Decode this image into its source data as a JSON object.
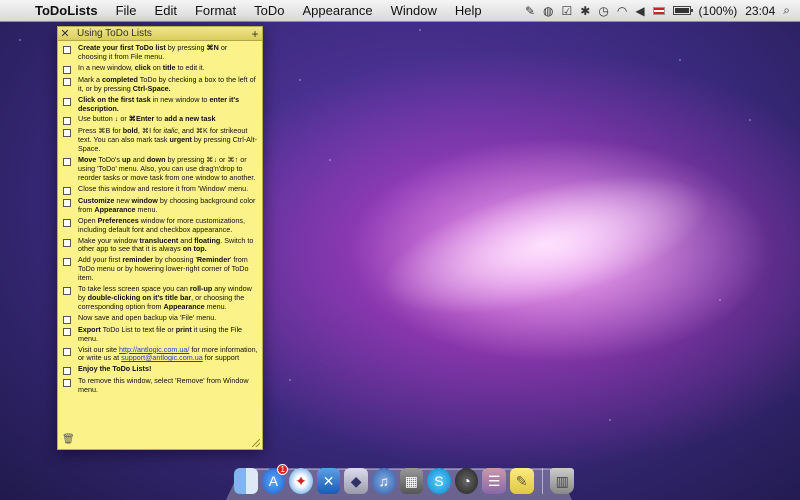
{
  "menubar": {
    "app_name": "ToDoLists",
    "menus": [
      "File",
      "Edit",
      "Format",
      "ToDo",
      "Appearance",
      "Window",
      "Help"
    ],
    "battery_text": "(100%)",
    "clock": "23:04"
  },
  "window": {
    "title": "Using ToDo Lists",
    "tasks": [
      {
        "html": "<b>Create your first ToDo list</b> by pressing <b>⌘N</b> or choosing it from File menu."
      },
      {
        "html": "In a new window, <b>click</b> on <b>title</b> to edit it."
      },
      {
        "html": "Mark a <b>completed</b> ToDo by checking a box to the left of it, or by pressing <b>Ctrl-Space.</b>"
      },
      {
        "html": "<b>Click on the first task</b> in new window to <b>enter it's description.</b>"
      },
      {
        "html": "Use button <b>↓</b> or <b>⌘Enter</b> to <b>add a new task</b>"
      },
      {
        "html": "Press ⌘B for <b>bold</b>, ⌘I for <i>italic</i>, and ⌘K for strikeout text. You can also mark task <b>urgent</b> by pressing Ctrl-Alt-Space."
      },
      {
        "html": "<b>Move</b> ToDo's <b>up</b> and <b>down</b> by pressing ⌘↓ or ⌘↑ or using 'ToDo' menu. Also, you can use drag'n'drop to reorder tasks or move task from one window to another."
      },
      {
        "html": "Close this window and restore it from 'Window' menu."
      },
      {
        "html": "<b>Customize</b> new <b>window</b> by choosing background color from <b>Appearance</b> menu."
      },
      {
        "html": "Open <b>Preferences</b> window for more customizations, including default font and checkbox appearance."
      },
      {
        "html": "Make your window <b>translucent</b> and <b>floating</b>. Switch to other app to see that it is always <b>on top.</b>"
      },
      {
        "html": "Add your first <b>reminder</b> by choosing '<b>Reminder</b>' from ToDo menu or by howering lower-right corner of ToDo item."
      },
      {
        "html": "To take less screen space you can <b>roll-up</b> any window by <b>double-clicking on it's title bar</b>, or choosing the corresponding option from <b>Appearance</b> menu."
      },
      {
        "html": "Now save and open backup via 'File' menu."
      },
      {
        "html": "<b>Export</b> ToDo List to text file or <b>print</b> it using the File menu."
      },
      {
        "html": "Visit our site <a>http://antlogic.com.ua/</a> for more information, or write us at <a>support@antlogic.com.ua</a> for support"
      },
      {
        "html": "<b>Enjoy the ToDo Lists!</b>"
      },
      {
        "html": "To remove this window, select 'Remove' from Window menu."
      }
    ]
  },
  "dock": {
    "mail_badge": "1",
    "icons": [
      "finder-icon",
      "app-store-icon",
      "safari-icon",
      "xcode-icon",
      "preview-icon",
      "itunes-icon",
      "photo-booth-icon",
      "skype-icon",
      "dashboard-icon",
      "todolists-icon",
      "notes-icon",
      "trash-icon"
    ]
  }
}
